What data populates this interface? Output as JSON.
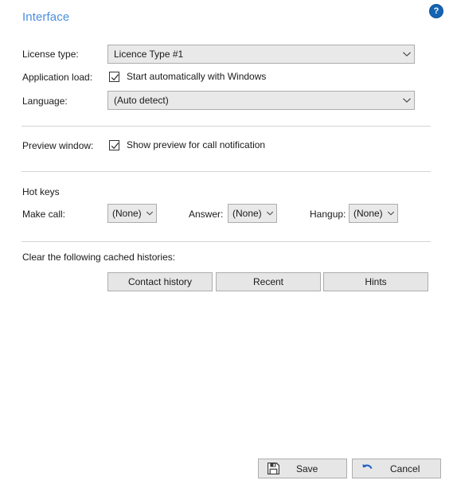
{
  "header": {
    "title": "Interface",
    "help_icon": "help-question-icon",
    "help_glyph": "?",
    "title_color": "#4a8ee0",
    "help_bg_color": "#1464b4"
  },
  "form": {
    "license_type": {
      "label": "License type:",
      "value": "Licence Type #1"
    },
    "application_load": {
      "label": "Application load:",
      "checkbox_label": "Start automatically with Windows",
      "checked": true
    },
    "language": {
      "label": "Language:",
      "value": "(Auto detect)"
    },
    "preview_window": {
      "label": "Preview window:",
      "checkbox_label": "Show preview for call notification",
      "checked": true
    }
  },
  "hot_keys": {
    "section_title": "Hot keys",
    "items": [
      {
        "label": "Make call:",
        "value": "(None)"
      },
      {
        "label": "Answer:",
        "value": "(None)"
      },
      {
        "label": "Hangup:",
        "value": "(None)"
      }
    ]
  },
  "clear_cache": {
    "title": "Clear the following cached histories:",
    "buttons": [
      {
        "label": "Contact history"
      },
      {
        "label": "Recent"
      },
      {
        "label": "Hints"
      }
    ]
  },
  "footer": {
    "save": {
      "label": "Save",
      "icon": "floppy-disk-save-icon"
    },
    "cancel": {
      "label": "Cancel",
      "icon": "undo-arrow-icon",
      "icon_color": "#1a5fc8"
    }
  }
}
